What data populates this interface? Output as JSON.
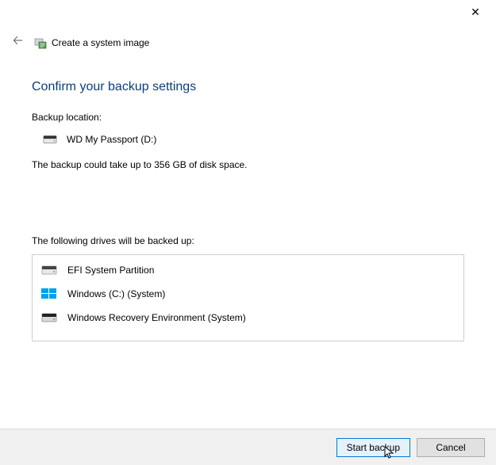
{
  "window": {
    "title": "Create a system image"
  },
  "page": {
    "heading": "Confirm your backup settings",
    "backup_location_label": "Backup location:",
    "backup_location_value": "WD My Passport (D:)",
    "disk_space_note": "The backup could take up to 356 GB of disk space.",
    "drives_heading": "The following drives will be backed up:"
  },
  "drives": [
    {
      "icon": "hdd",
      "label": "EFI System Partition"
    },
    {
      "icon": "win",
      "label": "Windows (C:) (System)"
    },
    {
      "icon": "hdd-dark",
      "label": "Windows Recovery Environment (System)"
    }
  ],
  "buttons": {
    "start": "Start backup",
    "cancel": "Cancel"
  }
}
